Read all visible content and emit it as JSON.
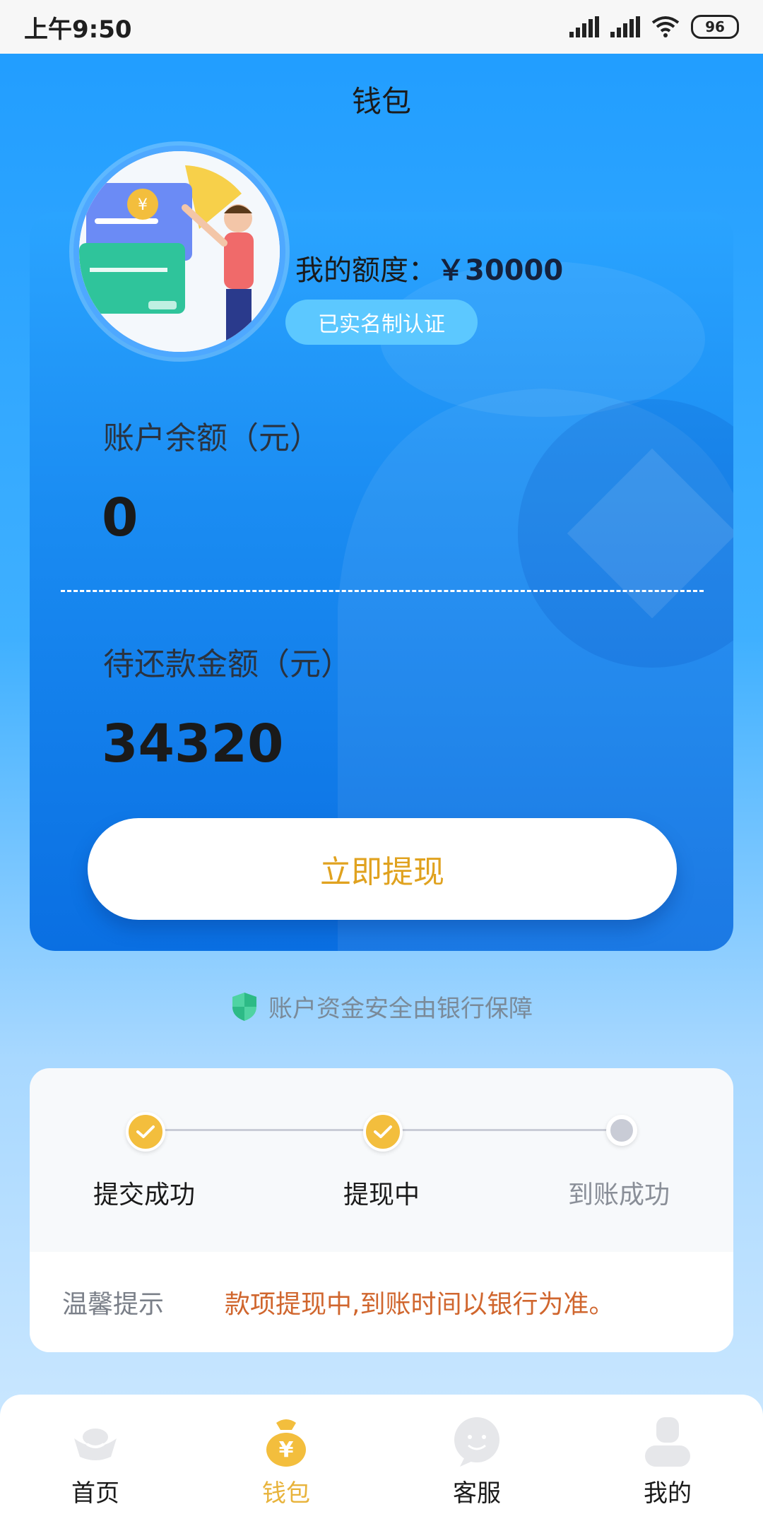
{
  "status_bar": {
    "time": "上午9:50",
    "battery": "96"
  },
  "header": {
    "title": "钱包"
  },
  "account": {
    "quota_label": "我的额度：",
    "quota_value": "￥30000",
    "verified_badge": "已实名制认证",
    "balance_label": "账户余额（元）",
    "balance_value": "0",
    "repay_label": "待还款金额（元）",
    "repay_value": "34320",
    "withdraw_button": "立即提现"
  },
  "security_note": "账户资金安全由银行保障",
  "progress": {
    "steps": [
      {
        "label": "提交成功",
        "done": true
      },
      {
        "label": "提现中",
        "done": true
      },
      {
        "label": "到账成功",
        "done": false
      }
    ],
    "tip_title": "温馨提示",
    "tip_text": "款项提现中,到账时间以银行为准。"
  },
  "tabbar": {
    "items": [
      {
        "label": "首页",
        "icon": "home-ingot-icon"
      },
      {
        "label": "钱包",
        "icon": "wallet-money-bag-icon"
      },
      {
        "label": "客服",
        "icon": "customer-service-chat-icon"
      },
      {
        "label": "我的",
        "icon": "profile-person-icon"
      }
    ],
    "active_index": 1
  },
  "colors": {
    "primary_blue": "#1a8cf2",
    "accent_gold": "#e0a21f",
    "tip_orange": "#d0662e"
  }
}
